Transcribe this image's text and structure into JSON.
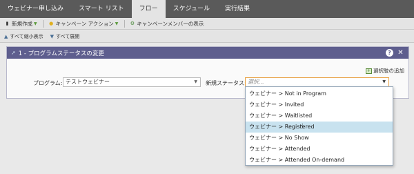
{
  "tabs": [
    {
      "label": "ウェビナー申し込み",
      "active": false
    },
    {
      "label": "スマート リスト",
      "active": false
    },
    {
      "label": "フロー",
      "active": true
    },
    {
      "label": "スケジュール",
      "active": false
    },
    {
      "label": "実行結果",
      "active": false
    }
  ],
  "toolbar": {
    "new_label": "新規作成",
    "campaign_action_label": "キャンペーン アクション",
    "show_members_label": "キャンペーンメンバーの表示"
  },
  "toolbar2": {
    "collapse_all_label": "すべて縮小表示",
    "expand_all_label": "すべて展開"
  },
  "panel": {
    "title": "1 - プログラムステータスの変更",
    "add_choice_label": "選択肢の追加",
    "program_label": "プログラム:",
    "program_value": "テストウェビナー",
    "status_label": "新規ステータス:",
    "status_placeholder": "選択..."
  },
  "dropdown": {
    "options": [
      "ウェビナー > Not in Program",
      "ウェビナー > Invited",
      "ウェビナー > Waitlisted",
      "ウェビナー > Registered",
      "ウェビナー > No Show",
      "ウェビナー > Attended",
      "ウェビナー > Attended On-demand"
    ],
    "highlighted_index": 3
  },
  "colors": {
    "tabbar": "#5a5a5a",
    "panel_header": "#5e5e8e",
    "highlight": "#c8e2ef",
    "focus_border": "#e8a040"
  }
}
